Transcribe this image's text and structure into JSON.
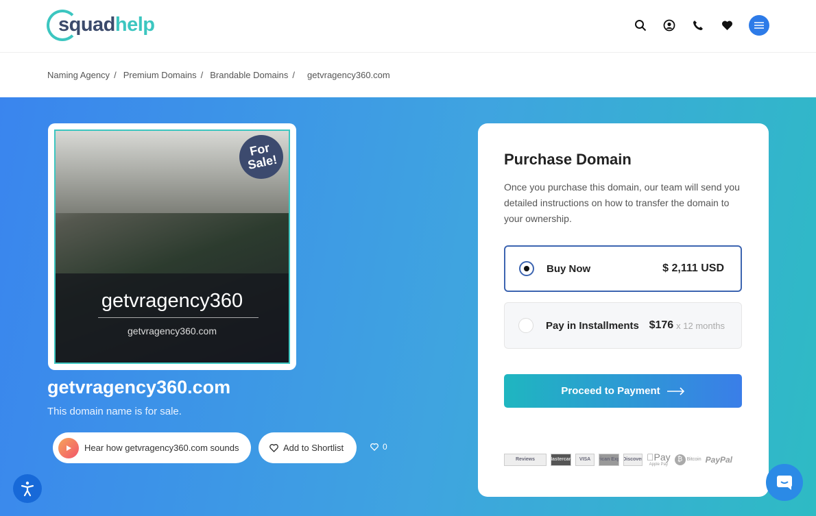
{
  "header": {
    "logo_a": "squad",
    "logo_b": "help",
    "icons": [
      "search-icon",
      "user-icon",
      "phone-icon",
      "heart-icon",
      "menu-icon"
    ]
  },
  "breadcrumb": [
    {
      "label": "Naming Agency"
    },
    {
      "label": "Premium Domains"
    },
    {
      "label": "Brandable Domains"
    },
    {
      "label": "getvragency360.com"
    }
  ],
  "breadcrumb_sep": "/",
  "listing": {
    "badge": "For Sale!",
    "overlay_name": "getvragency360",
    "overlay_domain": "getvragency360.com",
    "title": "getvragency360.com",
    "subtitle": "This domain name is for sale.",
    "hear_label": "Hear how getvragency360.com sounds",
    "shortlist_label": "Add to Shortlist",
    "likes": "0"
  },
  "purchase": {
    "title": "Purchase Domain",
    "description": "Once you purchase this domain, our team will send you detailed instructions on how to transfer the domain to your ownership.",
    "options": [
      {
        "label": "Buy Now",
        "price": "$ 2,111 USD",
        "selected": true
      },
      {
        "label": "Pay in Installments",
        "price": "$176",
        "suffix": "x 12 months",
        "selected": false
      }
    ],
    "proceed_label": "Proceed to Payment",
    "payment_logos": [
      "Reviews",
      "Mastercard",
      "VISA",
      "American Express",
      "Discover",
      "Apple Pay",
      "Bitcoin",
      "PayPal"
    ],
    "apple_pay": "Pay",
    "paypal": "PayPal"
  },
  "colors": {
    "accent": "#3cc6c0",
    "primary": "#2d7be8",
    "selected_border": "#3c64b0"
  }
}
